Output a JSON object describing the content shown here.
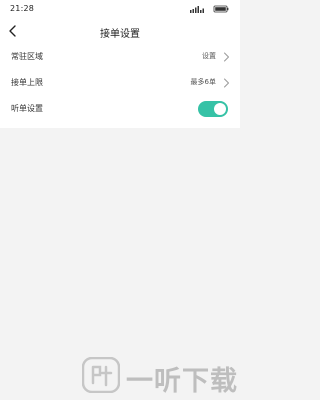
{
  "status_bar": {
    "time": "21:28"
  },
  "header": {
    "title": "接单设置",
    "back_icon": "chevron-left-icon"
  },
  "settings": {
    "rows": [
      {
        "label": "常驻区域",
        "value": "设置",
        "type": "link",
        "icon": "chevron-right-icon"
      },
      {
        "label": "接单上限",
        "value": "最多6单",
        "type": "link",
        "icon": "chevron-right-icon"
      },
      {
        "label": "听单设置",
        "value": "",
        "type": "toggle",
        "toggle_on": true
      }
    ]
  },
  "colors": {
    "toggle_on": "#36c2a6",
    "background": "#f3f3f3",
    "surface": "#ffffff"
  },
  "watermark": {
    "text": "一听下载"
  }
}
